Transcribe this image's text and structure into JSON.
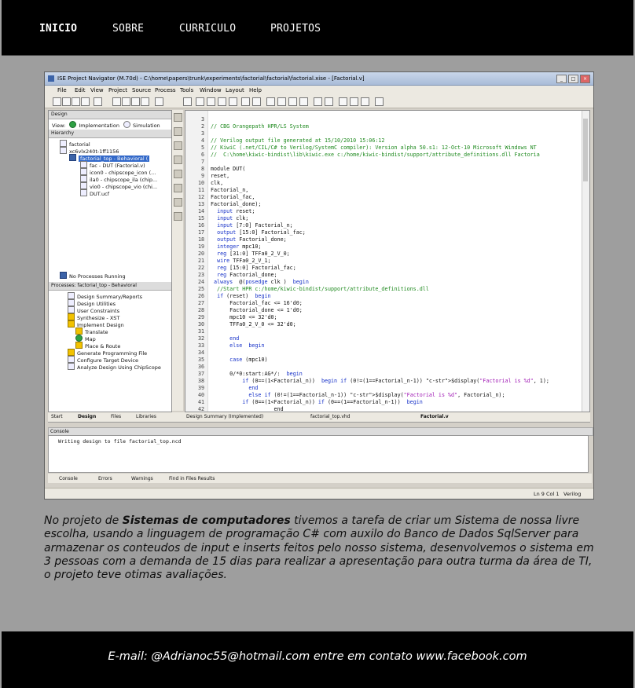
{
  "nav": {
    "items": [
      "INICIO",
      "SOBRE",
      "CURRICULO",
      "PROJETOS"
    ],
    "active": "INICIO"
  },
  "screenshot": {
    "window_title": "ISE Project Navigator (M.70d) - C:\\home\\papers\\trunk\\experiments\\factorial\\factorial\\factorial.xise - [Factorial.v]",
    "menu": [
      "File",
      "Edit",
      "View",
      "Project",
      "Source",
      "Process",
      "Tools",
      "Window",
      "Layout",
      "Help"
    ],
    "design_panel": {
      "title": "Design",
      "view_label": "View:",
      "view_impl": "Implementation",
      "view_sim": "Simulation",
      "hierarchy_label": "Hierarchy",
      "tree": [
        "factorial",
        "xc6vlx240t-1ff1156",
        "factorial_top - Behavioral (",
        "fac - DUT (Factorial.v)",
        "icon0 - chipscope_icon (...",
        "ila0 - chipscope_ila (chip...",
        "vio0 - chipscope_vio (chi...",
        "DUT.ucf"
      ],
      "no_processes": "No Processes Running",
      "processes_label": "Processes: factorial_top - Behavioral",
      "processes": [
        "Design Summary/Reports",
        "Design Utilities",
        "User Constraints",
        "Synthesize - XST",
        "Implement Design",
        "Translate",
        "Map",
        "Place & Route",
        "Generate Programming File",
        "Configure Target Device",
        "Analyze Design Using ChipScope"
      ]
    },
    "code_lines": [
      {
        "n": "3",
        "t": ""
      },
      {
        "n": "2",
        "t": "// CBG Orangepath HPR/LS System",
        "c": "cmt"
      },
      {
        "n": "3",
        "t": ""
      },
      {
        "n": "4",
        "t": "// Verilog output file generated at 15/10/2010 15:06:12",
        "c": "cmt"
      },
      {
        "n": "5",
        "t": "// KiwiC (.net/CIL/C# to Verilog/SystemC compiler): Version alpha 50.s1: 12-Oct-10 Microsoft Windows NT",
        "c": "cmt"
      },
      {
        "n": "6",
        "t": "//  C:\\home\\kiwic-bindist\\lib\\kiwic.exe c:/home/kiwic-bindist/support/attribute_definitions.dll Factoria",
        "c": "cmt"
      },
      {
        "n": "7",
        "t": ""
      },
      {
        "n": "8",
        "t": "module DUT("
      },
      {
        "n": "9",
        "t": "reset,"
      },
      {
        "n": "10",
        "t": "clk,"
      },
      {
        "n": "11",
        "t": "Factorial_n,"
      },
      {
        "n": "12",
        "t": "Factorial_fac,"
      },
      {
        "n": "13",
        "t": "Factorial_done);"
      },
      {
        "n": "14",
        "t": "  input reset;",
        "c": "kwline"
      },
      {
        "n": "15",
        "t": "  input clk;",
        "c": "kwline"
      },
      {
        "n": "16",
        "t": "  input [7:0] Factorial_n;",
        "c": "kwline"
      },
      {
        "n": "17",
        "t": "  output [15:0] Factorial_fac;",
        "c": "kwline"
      },
      {
        "n": "18",
        "t": "  output Factorial_done;",
        "c": "kwline"
      },
      {
        "n": "19",
        "t": "  integer mpc10;",
        "c": "kwline"
      },
      {
        "n": "20",
        "t": "  reg [31:0] TFFa0_2_V_0;",
        "c": "kwline"
      },
      {
        "n": "21",
        "t": "  wire TFFa0_2_V_1;",
        "c": "kwline"
      },
      {
        "n": "22",
        "t": "  reg [15:0] Factorial_fac;",
        "c": "kwline"
      },
      {
        "n": "23",
        "t": "  reg Factorial_done;",
        "c": "kwline"
      },
      {
        "n": "24",
        "t": " always  @(posedge clk )  begin",
        "c": "kwline"
      },
      {
        "n": "25",
        "t": "  //Start HPR c:/home/kiwic-bindist/support/attribute_definitions.dll",
        "c": "cmt"
      },
      {
        "n": "26",
        "t": "  if (reset)  begin",
        "c": "kwline"
      },
      {
        "n": "27",
        "t": "      Factorial_fac <= 16'd0;"
      },
      {
        "n": "28",
        "t": "      Factorial_done <= 1'd0;"
      },
      {
        "n": "29",
        "t": "      mpc10 <= 32'd0;"
      },
      {
        "n": "30",
        "t": "      TFFa0_2_V_0 <= 32'd0;"
      },
      {
        "n": "31",
        "t": ""
      },
      {
        "n": "32",
        "t": "      end",
        "c": "kwline"
      },
      {
        "n": "33",
        "t": "      else  begin",
        "c": "kwline"
      },
      {
        "n": "34",
        "t": ""
      },
      {
        "n": "35",
        "t": "      case (mpc10)",
        "c": "kwline"
      },
      {
        "n": "36",
        "t": ""
      },
      {
        "n": "37",
        "t": "      0/*0:start:AG*/:  begin",
        "c": "kwline"
      },
      {
        "n": "38",
        "t": "          if (0==(1<Factorial_n))  begin if (0!=(1==Factorial_n-1)) $display(\"Factorial is %d\", 1);",
        "c": "mixed1"
      },
      {
        "n": "39",
        "t": "            end",
        "c": "kwline"
      },
      {
        "n": "40",
        "t": "            else if (0!=(1==Factorial_n-1)) $display(\"Factorial is %d\", Factorial_n);",
        "c": "mixed2"
      },
      {
        "n": "41",
        "t": "          if (0==(1<Factorial_n)) if (0==(1==Factorial_n-1))  begin",
        "c": "kwline"
      },
      {
        "n": "42",
        "t": "                    end"
      }
    ],
    "editor_tabs": [
      "Start",
      "Design",
      "Files",
      "Libraries",
      "Design Summary (Implemented)",
      "factorial_top.vhd",
      "Factorial.v"
    ],
    "console_title": "Console",
    "console_text": "Writing design to file factorial_top.ncd",
    "console_tabs": [
      "Console",
      "Errors",
      "Warnings",
      "Find in Files Results"
    ],
    "status": {
      "position": "Ln 9 Col 1",
      "language": "Verilog"
    }
  },
  "description": {
    "prefix": "No projeto de ",
    "bold": "Sistemas de computadores",
    "suffix": " tivemos a tarefa de criar um Sistema de nossa livre escolha, usando a linguagem de programação C# com auxilo do Banco de Dados SqlServer para armazenar os conteudos de input e inserts feitos pelo nosso sistema, desenvolvemos o sistema em 3 pessoas com a demanda de 15 dias para realizar a apresentação para outra turma da área de TI, o projeto teve otimas avaliações."
  },
  "footer": {
    "text": "E-mail: @Adrianoc55@hotmail.com entre em contato www.facebook.com"
  }
}
